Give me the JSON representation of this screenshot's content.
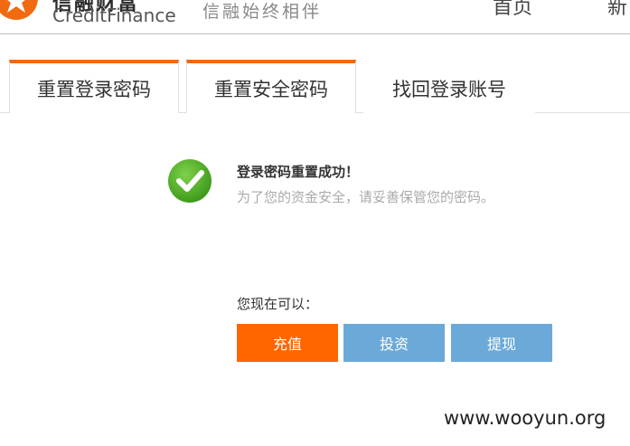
{
  "header": {
    "brand_cn": "信融财富",
    "brand_en": "CreditFinance",
    "slogan": "信融始终相伴",
    "nav": [
      "首页",
      "新"
    ]
  },
  "tabs": [
    {
      "label": "重置登录密码",
      "active": true
    },
    {
      "label": "重置安全密码",
      "active": true
    },
    {
      "label": "找回登录账号",
      "active": false
    }
  ],
  "success": {
    "title": "登录密码重置成功！",
    "subtitle": "为了您的资金安全，请妥善保管您的密码。"
  },
  "actions": {
    "prompt": "您现在可以：",
    "buttons": [
      "充值",
      "投资",
      "提现"
    ]
  },
  "watermark": "www.wooyun.org",
  "colors": {
    "accent_orange": "#ff6600",
    "tab_border": "#f26a10",
    "button_blue": "#6baad8",
    "success_green": "#5cb82e"
  }
}
